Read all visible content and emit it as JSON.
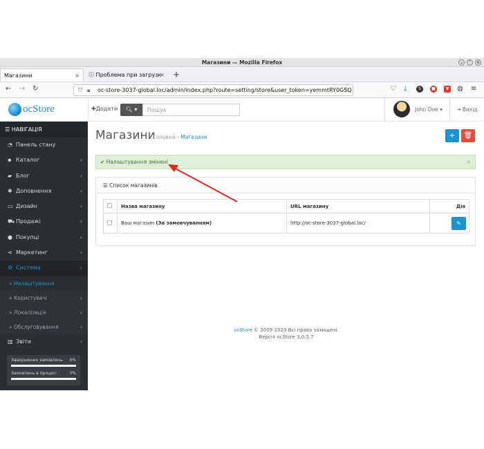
{
  "window": {
    "title": "Магазини — Mozilla Firefox"
  },
  "tabs": [
    {
      "label": "Магазини"
    },
    {
      "label": "Проблема при загрузк"
    }
  ],
  "browser": {
    "url": "oc-store-3037-global.loc/admin/index.php?route=setting/store&user_token=yemmtRY0G5Q"
  },
  "header": {
    "logo_text": "ocStore",
    "add_label": "Додати",
    "search_placeholder": "Пошук",
    "user_name": "John Doe",
    "logout_label": "Вихід"
  },
  "sidebar": {
    "heading": "НАВІГАЦІЯ",
    "items": [
      {
        "label": "Панель стану"
      },
      {
        "label": "Каталог"
      },
      {
        "label": "Блог"
      },
      {
        "label": "Доповнення"
      },
      {
        "label": "Дизайн"
      },
      {
        "label": "Продажі"
      },
      {
        "label": "Покупці"
      },
      {
        "label": "Маркетинг"
      },
      {
        "label": "Система"
      }
    ],
    "subitems": [
      {
        "label": "Налаштування"
      },
      {
        "label": "Користувачі"
      },
      {
        "label": "Локалізація"
      },
      {
        "label": "Обслуговування"
      }
    ],
    "reports_label": "Звіти",
    "stats": [
      {
        "label": "Завершених замовлень",
        "value": "0%",
        "progress": 0
      },
      {
        "label": "Замовлень в процесі",
        "value": "0%",
        "progress": 0
      }
    ]
  },
  "main": {
    "title": "Магазини",
    "breadcrumb_home": "Головна",
    "breadcrumb_current": "Магазини",
    "alert_text": "Налаштування змінені",
    "panel_title": "Список магазинів",
    "table": {
      "headers": [
        "Назва магазину",
        "URL магазину",
        "Дія"
      ],
      "rows": [
        {
          "name": "Ваш магазин",
          "name_suffix": "(За замовчуванням)",
          "url": "http://oc-store-3037-global.loc/"
        }
      ]
    },
    "footer_brand": "ocStore",
    "footer_copy": "© 2009-2023 Всі права захищені.",
    "footer_version": "Версія ocStore 3.0.3.7"
  },
  "colors": {
    "accent": "#1e91cf",
    "danger": "#e74c3c",
    "sidebar_bg": "#2b2e33",
    "alert_bg": "#dff0d8",
    "annotation_arrow": "#e0261e"
  }
}
